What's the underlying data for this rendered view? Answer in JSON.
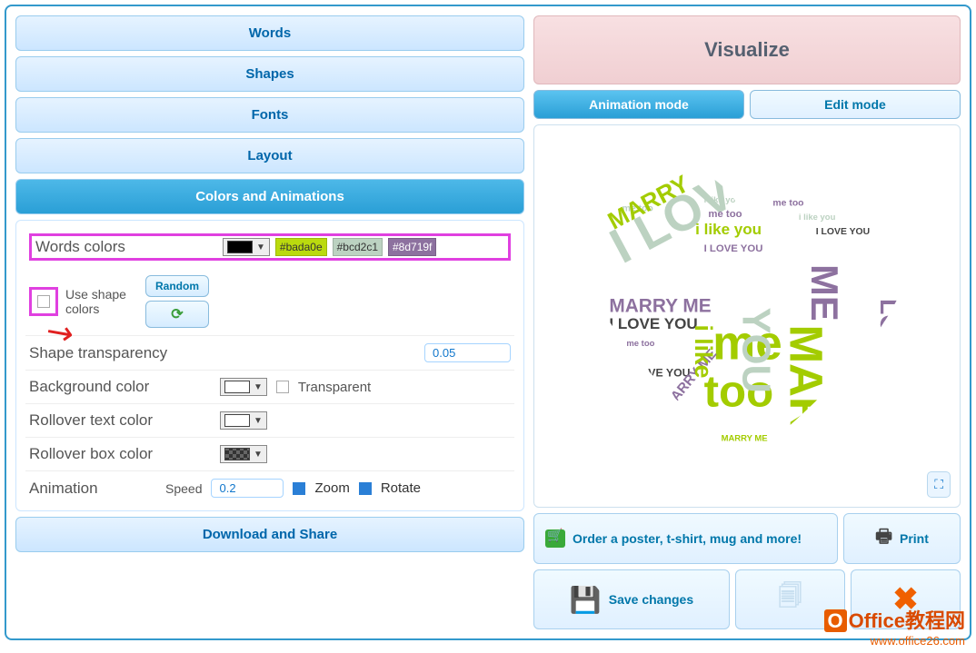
{
  "left": {
    "tabs": {
      "words": "Words",
      "shapes": "Shapes",
      "fonts": "Fonts",
      "layout": "Layout",
      "colors": "Colors and Animations",
      "download": "Download and Share"
    },
    "words_colors": {
      "label": "Words colors",
      "hex1": "#bada0e",
      "hex2": "#bcd2c1",
      "hex3": "#8d719f",
      "use_shape": "Use shape colors",
      "random": "Random"
    },
    "shape_transparency": {
      "label": "Shape transparency",
      "value": "0.05"
    },
    "background_color": {
      "label": "Background color",
      "transparent": "Transparent"
    },
    "rollover_text": {
      "label": "Rollover text color"
    },
    "rollover_box": {
      "label": "Rollover box color"
    },
    "animation": {
      "label": "Animation",
      "speed_label": "Speed",
      "speed_value": "0.2",
      "zoom": "Zoom",
      "rotate": "Rotate"
    }
  },
  "right": {
    "visualize": "Visualize",
    "mode_anim": "Animation mode",
    "mode_edit": "Edit mode",
    "order": "Order a poster, t-shirt, mug and more!",
    "print": "Print",
    "save": "Save changes"
  },
  "watermark": {
    "line1_zh": "Office教程网",
    "line2": "www.office26.com"
  },
  "colors": {
    "c1": "#bada0e",
    "c2": "#bcd2c1",
    "c3": "#8d719f",
    "white": "#ffffff",
    "black": "#000000",
    "checker": "#888888"
  },
  "chart_data": {
    "type": "wordcloud",
    "shape": "heart",
    "palette": [
      "#bada0e",
      "#bcd2c1",
      "#8d719f"
    ],
    "words": [
      {
        "text": "I LOVE YOU",
        "weight": 10
      },
      {
        "text": "MARRY ME",
        "weight": 9
      },
      {
        "text": "me too",
        "weight": 8
      },
      {
        "text": "i like you",
        "weight": 6
      },
      {
        "text": "I LOVE YOU I LOVE YOU",
        "weight": 3
      },
      {
        "text": "like you",
        "weight": 2
      }
    ]
  }
}
